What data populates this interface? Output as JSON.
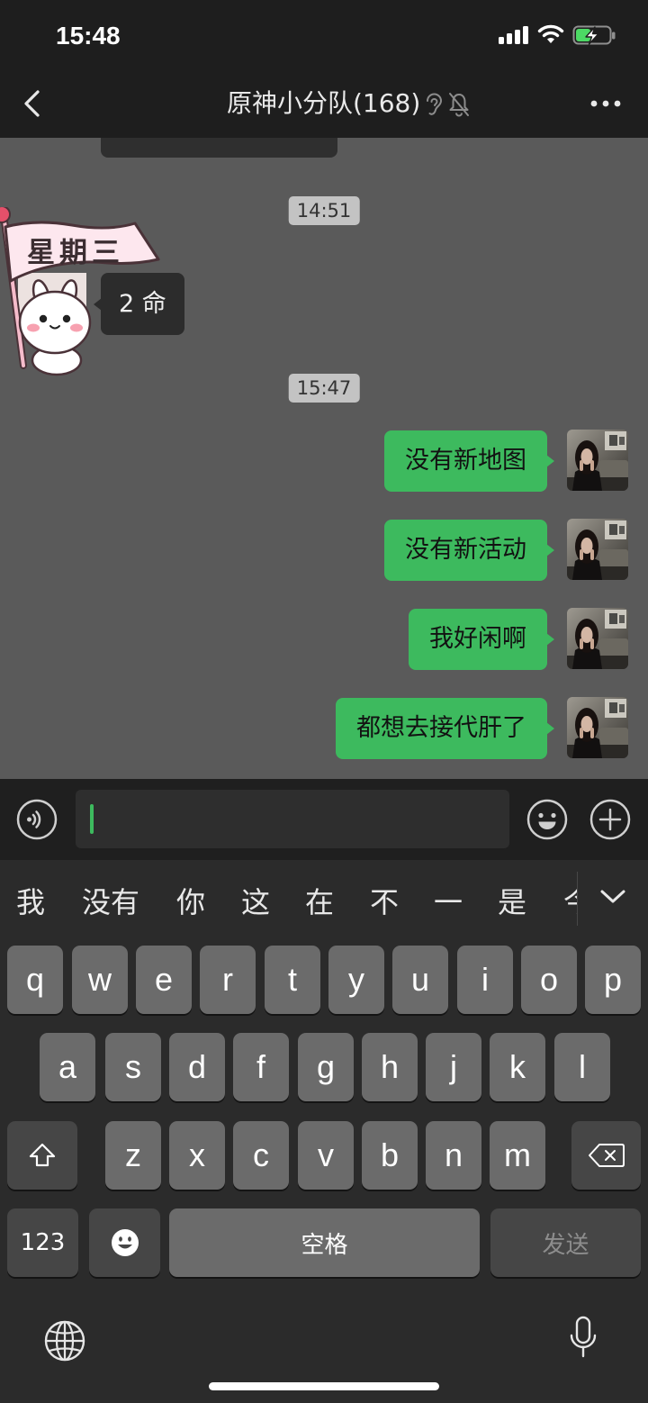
{
  "status_bar": {
    "time": "15:48",
    "battery_level": 0.45,
    "battery_color": "#4cd964",
    "icons": [
      "cellular-signal-icon",
      "wifi-icon",
      "battery-charging-icon"
    ]
  },
  "nav_bar": {
    "title": "原神小分队(168)",
    "icons": [
      "chevron-left-icon",
      "ear-icon",
      "bell-slash-icon",
      "more-dots-icon"
    ]
  },
  "chat": {
    "timestamps": [
      "14:51",
      "15:47"
    ],
    "incoming": {
      "avatar_flag_text": "星期三",
      "text": "2 命"
    },
    "outgoing": [
      {
        "text": "没有新地图"
      },
      {
        "text": "没有新活动"
      },
      {
        "text": "我好闲啊"
      },
      {
        "text": "都想去接代肝了"
      }
    ]
  },
  "input_bar": {
    "value": "",
    "icons": [
      "voice-icon",
      "emoji-icon",
      "plus-icon"
    ]
  },
  "keyboard": {
    "suggestions": [
      "我",
      "没有",
      "你",
      "这",
      "在",
      "不",
      "一",
      "是",
      "今"
    ],
    "rows": [
      [
        "q",
        "w",
        "e",
        "r",
        "t",
        "y",
        "u",
        "i",
        "o",
        "p"
      ],
      [
        "a",
        "s",
        "d",
        "f",
        "g",
        "h",
        "j",
        "k",
        "l"
      ],
      [
        "z",
        "x",
        "c",
        "v",
        "b",
        "n",
        "m"
      ]
    ],
    "numbers_key": "123",
    "space_key": "空格",
    "send_key": "发送",
    "icons": [
      "chevron-down-icon",
      "shift-icon",
      "backspace-icon",
      "emoji-key-icon",
      "globe-icon",
      "microphone-icon"
    ]
  },
  "colors": {
    "bar_background": "#1e1e1e",
    "chat_background": "#5a5a5a",
    "outgoing_bubble": "#3dba5e",
    "incoming_bubble": "#2c2c2c",
    "keyboard_background": "#2b2b2b",
    "letter_key": "#6b6b6b",
    "function_key": "#464646",
    "cursor": "#3dba5e"
  }
}
